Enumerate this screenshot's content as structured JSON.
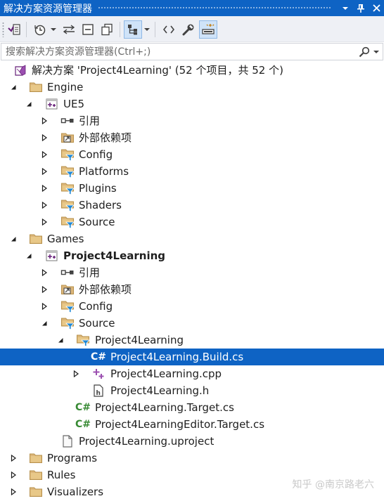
{
  "window": {
    "title": "解决方案资源管理器",
    "buttons": [
      "chevron-down-icon",
      "pin-icon",
      "close-icon"
    ]
  },
  "toolbar": {
    "items": [
      "switch-views-icon",
      "history-icon",
      "dropdown-arrow-icon",
      "sync-icon",
      "collapse-all-icon",
      "copy-icon",
      "show-all-files-icon",
      "dropdown-arrow-icon",
      "code-view-icon",
      "properties-wrench-icon",
      "preview-selected-icon"
    ]
  },
  "search": {
    "placeholder": "搜索解决方案资源管理器(Ctrl+;)"
  },
  "tree": {
    "solution": "解决方案 'Project4Learning' (52 个项目，共 52 个)",
    "engine": "Engine",
    "ue5": "UE5",
    "ue5_refs": "引用",
    "ue5_ext": "外部依赖项",
    "ue5_config": "Config",
    "ue5_platforms": "Platforms",
    "ue5_plugins": "Plugins",
    "ue5_shaders": "Shaders",
    "ue5_source": "Source",
    "games": "Games",
    "project": "Project4Learning",
    "proj_refs": "引用",
    "proj_ext": "外部依赖项",
    "proj_config": "Config",
    "proj_source": "Source",
    "proj_source_folder": "Project4Learning",
    "build_cs": "Project4Learning.Build.cs",
    "cpp": "Project4Learning.cpp",
    "header": "Project4Learning.h",
    "target_cs": "Project4Learning.Target.cs",
    "editor_target_cs": "Project4LearningEditor.Target.cs",
    "uproject": "Project4Learning.uproject",
    "programs": "Programs",
    "rules": "Rules",
    "visualizers": "Visualizers"
  },
  "watermark": "知乎 @南京路老六",
  "colors": {
    "accent": "#0e63c4",
    "folder": "#dcb67a",
    "csharp": "#388a34",
    "filter": "#1e88d6"
  }
}
